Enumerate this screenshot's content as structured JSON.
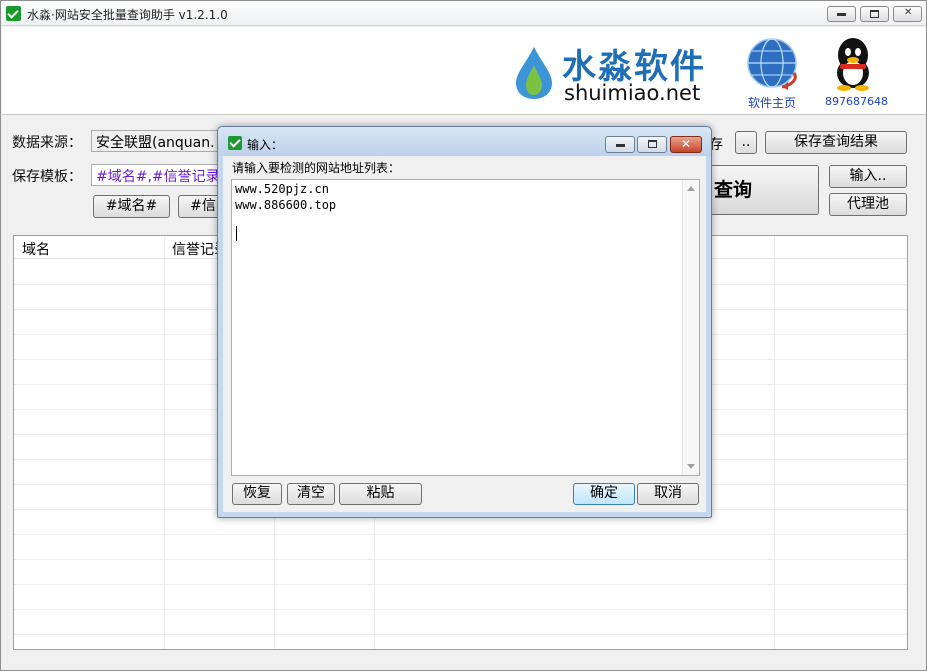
{
  "window": {
    "title": "水淼·网站安全批量查询助手 v1.2.1.0"
  },
  "header": {
    "logo_cn": "水淼软件",
    "logo_en": "shuimiao.net",
    "home_link": "软件主页",
    "qq_number": "897687648"
  },
  "form": {
    "source_label": "数据来源：",
    "source_value": "安全联盟(anquan.",
    "template_label": "保存模板：",
    "template_value": "#域名#,#信誉记录",
    "tag_buttons": [
      "#域名#",
      "#信"
    ],
    "save_partial": "存",
    "browse_button": "..",
    "save_results_button": "保存查询结果",
    "query_button": "查询",
    "input_button": "输入..",
    "proxy_button": "代理池"
  },
  "grid": {
    "columns": [
      "域名",
      "信誉记录"
    ]
  },
  "dialog": {
    "title": "输入：",
    "prompt": "请输入要检测的网站地址列表：",
    "lines": [
      "www.520pjz.cn",
      "www.886600.top"
    ],
    "buttons": {
      "restore": "恢复",
      "clear": "清空",
      "paste": "粘贴",
      "ok": "确定",
      "cancel": "取消"
    }
  },
  "colors": {
    "accent_blue": "#1f6fb7",
    "link_blue": "#1c44c8",
    "template_purple": "#6a1bd1",
    "icon_green": "#1a9a2e"
  }
}
